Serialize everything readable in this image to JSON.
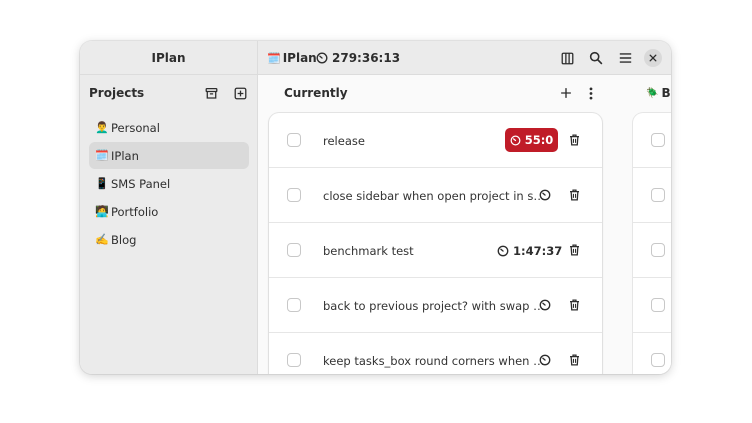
{
  "sidebar": {
    "app_title": "IPlan",
    "projects_label": "Projects",
    "icons": {
      "archive": "archive-icon",
      "add": "add-project-icon"
    },
    "items": [
      {
        "emoji": "👨‍🦱",
        "label": "Personal",
        "active": false
      },
      {
        "emoji": "🗓️",
        "label": "IPlan",
        "active": true
      },
      {
        "emoji": "📱",
        "label": "SMS Panel",
        "active": false
      },
      {
        "emoji": "🧑‍💻",
        "label": "Portfolio",
        "active": false
      },
      {
        "emoji": "✍️",
        "label": "Blog",
        "active": false
      }
    ]
  },
  "header": {
    "project_emoji": "🗓️",
    "project_name": "IPlan",
    "total_time": "279:36:13",
    "buttons": [
      "columns-icon",
      "search-icon",
      "menu-icon",
      "close-icon"
    ]
  },
  "columns": [
    {
      "title": "Currently",
      "tasks": [
        {
          "name": "release",
          "timer": "55:0",
          "timer_running": true
        },
        {
          "name": "close sidebar when open project in s…",
          "timer": "",
          "timer_running": false
        },
        {
          "name": "benchmark test",
          "timer": "1:47:37",
          "timer_running": false
        },
        {
          "name": "back to previous project? with swap …",
          "timer": "",
          "timer_running": false
        },
        {
          "name": "keep tasks_box round corners when …",
          "timer": "",
          "timer_running": false
        }
      ]
    },
    {
      "title_emoji": "🪲",
      "title": "Bu"
    }
  ],
  "colors": {
    "accent_red": "#c01c28",
    "sidebar_bg": "#ebebeb",
    "active_item": "#dadada"
  }
}
